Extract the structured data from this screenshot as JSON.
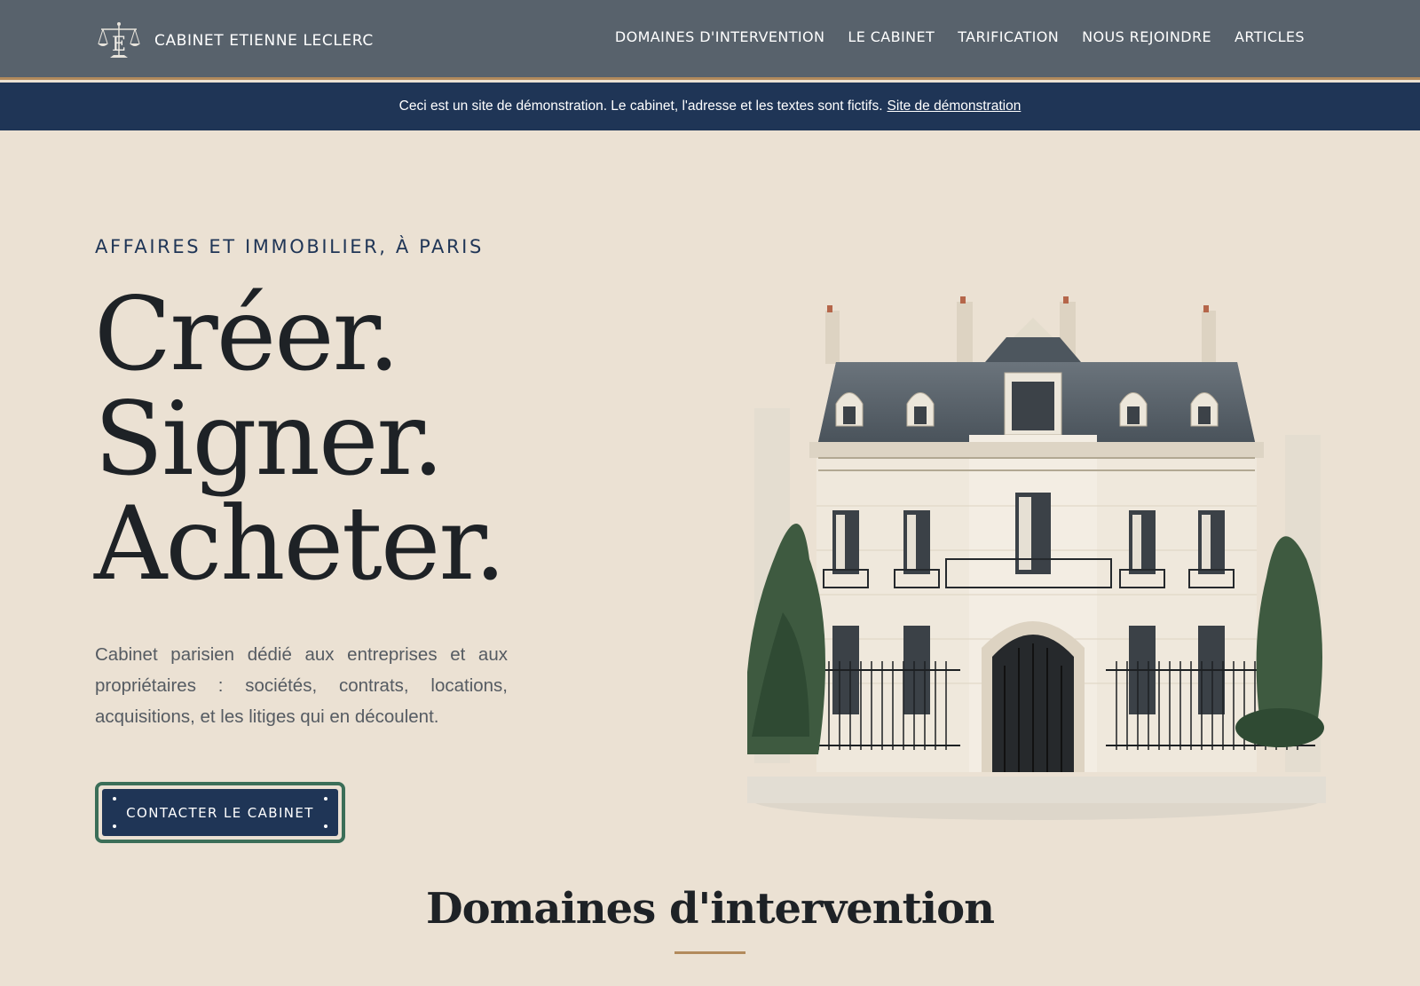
{
  "header": {
    "brand_name": "CABINET ETIENNE LECLERC",
    "logo_icon": "scales-of-justice-icon",
    "nav": [
      {
        "label": "DOMAINES D'INTERVENTION"
      },
      {
        "label": "LE CABINET"
      },
      {
        "label": "TARIFICATION"
      },
      {
        "label": "NOUS REJOINDRE"
      },
      {
        "label": "ARTICLES"
      }
    ]
  },
  "banner": {
    "text": "Ceci est un site de démonstration. Le cabinet, l'adresse et les textes sont fictifs.",
    "link_label": "Site de démonstration"
  },
  "hero": {
    "eyebrow": "AFFAIRES ET IMMOBILIER, À PARIS",
    "title_lines": [
      "Créer.",
      "Signer.",
      "Acheter."
    ],
    "description": "Cabinet parisien dédié aux entreprises et aux propriétaires : sociétés, contrats, locations, acquisitions, et les litiges qui en découlent.",
    "cta_label": "CONTACTER LE CABINET"
  },
  "section": {
    "title": "Domaines d'intervention"
  },
  "colors": {
    "header_bg": "#58626c",
    "banner_bg": "#1f3556",
    "page_bg": "#ebe1d3",
    "accent": "#b28a5c",
    "cta_border": "#3b6e58"
  }
}
